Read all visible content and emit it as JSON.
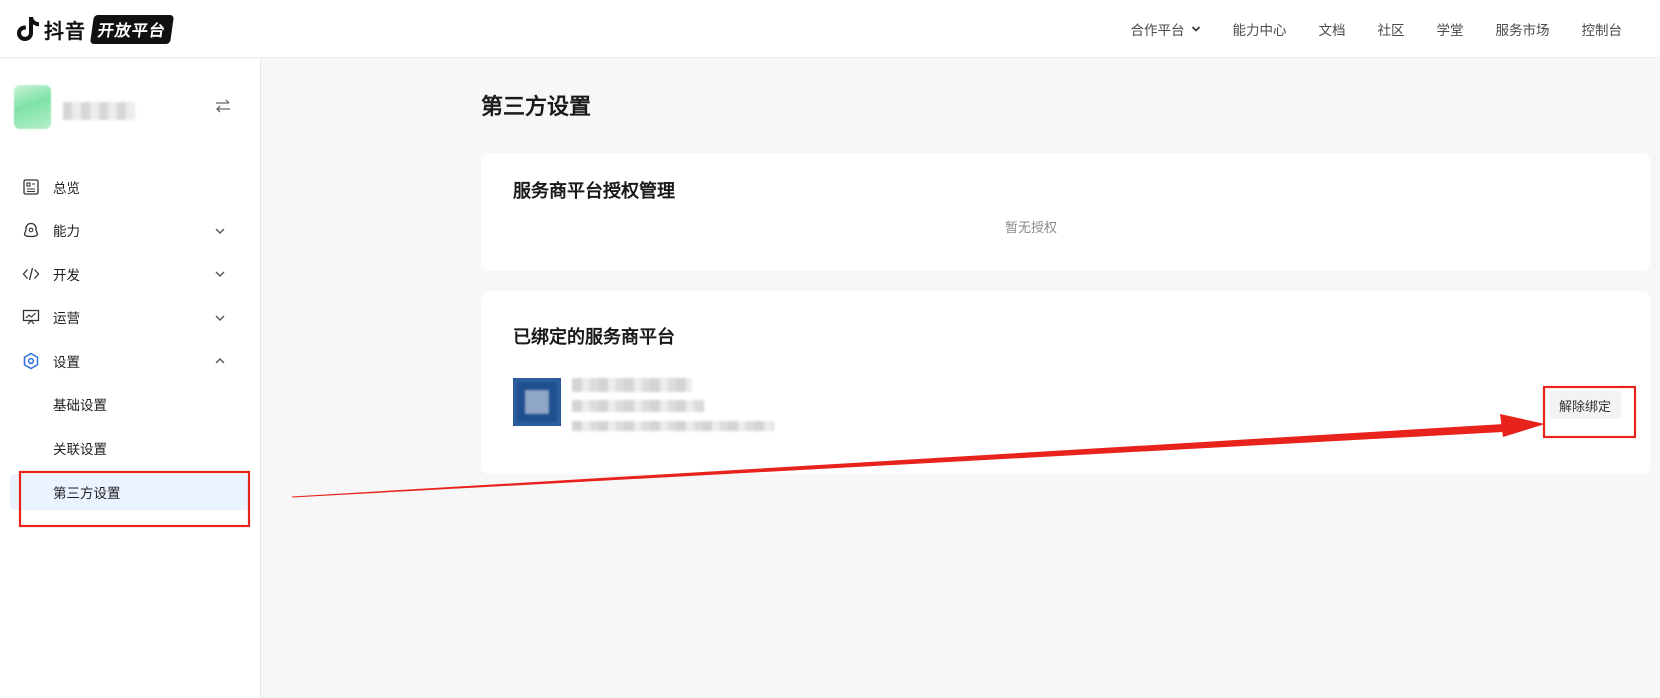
{
  "topbar": {
    "logo_text": "抖音",
    "logo_badge": "开放平台",
    "nav": [
      {
        "label": "合作平台",
        "has_dropdown": true
      },
      {
        "label": "能力中心"
      },
      {
        "label": "文档"
      },
      {
        "label": "社区"
      },
      {
        "label": "学堂"
      },
      {
        "label": "服务市场"
      },
      {
        "label": "控制台"
      }
    ]
  },
  "sidebar": {
    "app": {
      "avatar": "blurred-app-avatar",
      "name": "",
      "switch_icon": "switch-arrows-icon"
    },
    "menu": [
      {
        "label": "总览",
        "icon": "overview-icon"
      },
      {
        "label": "能力",
        "icon": "capability-icon",
        "expanded": false
      },
      {
        "label": "开发",
        "icon": "code-icon",
        "expanded": false
      },
      {
        "label": "运营",
        "icon": "operations-icon",
        "expanded": false
      },
      {
        "label": "设置",
        "icon": "settings-icon",
        "expanded": true,
        "active_color": "#2f6fe6"
      }
    ],
    "submenu": [
      {
        "label": "基础设置"
      },
      {
        "label": "关联设置"
      },
      {
        "label": "第三方设置",
        "active": true
      }
    ]
  },
  "main": {
    "page_title": "第三方设置",
    "auth_card": {
      "title": "服务商平台授权管理",
      "empty_text": "暂无授权"
    },
    "bound_card": {
      "title": "已绑定的服务商平台",
      "provider": {
        "logo_color": "#1f4f8f",
        "name": "",
        "detail": ""
      },
      "unbind_button": "解除绑定"
    }
  },
  "annotation": {
    "color": "#e8231c"
  }
}
